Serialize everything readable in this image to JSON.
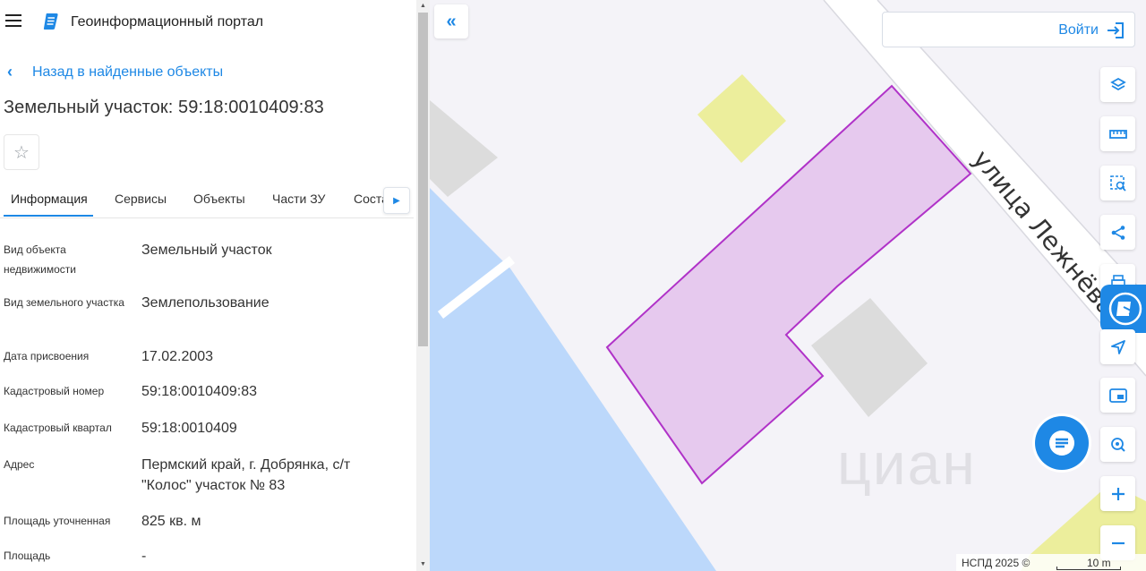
{
  "header": {
    "title": "Геоинформационный портал",
    "logo_color": "#1e88e5"
  },
  "back_link": {
    "label": "Назад в найденные объекты"
  },
  "object": {
    "title": "Земельный участок: 59:18:0010409:83"
  },
  "tabs": [
    {
      "label": "Информация",
      "active": true
    },
    {
      "label": "Сервисы"
    },
    {
      "label": "Объекты"
    },
    {
      "label": "Части ЗУ"
    },
    {
      "label": "Состав"
    }
  ],
  "details": [
    {
      "label": "Вид объекта недвижимости",
      "value": "Земельный участок"
    },
    {
      "label": "Вид земельного участка",
      "value": "Землепользование"
    },
    {
      "label": "Дата присвоения",
      "value": "17.02.2003"
    },
    {
      "label": "Кадастровый номер",
      "value": "59:18:0010409:83"
    },
    {
      "label": "Кадастровый квартал",
      "value": "59:18:0010409"
    },
    {
      "label": "Адрес",
      "value": "Пермский край, г. Добрянка, с/т \"Колос\" участок № 83"
    },
    {
      "label": "Площадь уточненная",
      "value": "825 кв. м"
    },
    {
      "label": "Площадь",
      "value": "-"
    }
  ],
  "map": {
    "login_label": "Войти",
    "street_label": "улица Лежнёва",
    "watermark": "циан",
    "attribution": "НСПД 2025 ©",
    "scale": "10 m",
    "colors": {
      "background": "#f4f3f8",
      "water": "#bcd8fb",
      "parcel_fill": "#e6c9ee",
      "parcel_stroke": "#b032c8",
      "building": "#dcdcdc",
      "yellow_area": "#ecee9c",
      "accent": "#1e88e5"
    },
    "tools": [
      "layers-icon",
      "ruler-icon",
      "select-area-icon",
      "share-icon",
      "print-icon",
      "navigate-icon",
      "minimap-icon",
      "location-search-icon",
      "zoom-in-icon",
      "zoom-out-icon"
    ]
  }
}
